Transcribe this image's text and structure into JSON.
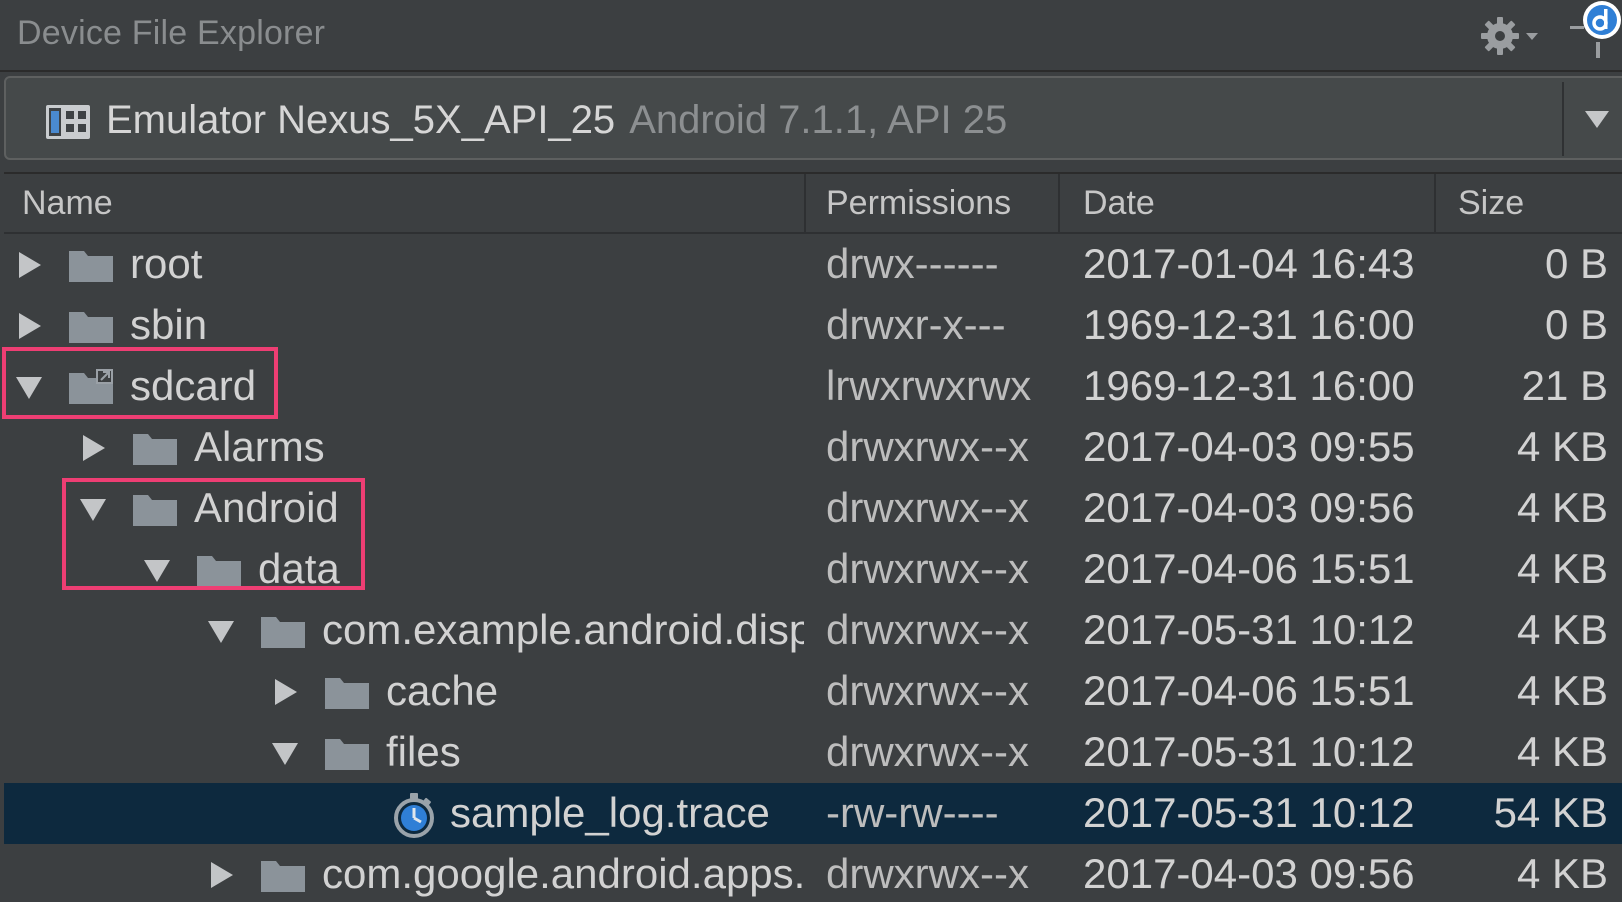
{
  "window": {
    "title": "Device File Explorer",
    "settings_icon": "gear-icon",
    "corner_icon": "d-badge-icon"
  },
  "device": {
    "name": "Emulator Nexus_5X_API_25",
    "api": "Android 7.1.1, API 25",
    "icon": "device-icon"
  },
  "columns": {
    "name": "Name",
    "permissions": "Permissions",
    "date": "Date",
    "size": "Size"
  },
  "rows": [
    {
      "name": "root",
      "permissions": "drwx------",
      "date": "2017-01-04 16:43",
      "size": "0 B",
      "depth": 0,
      "expanded": false,
      "icon": "folder-icon"
    },
    {
      "name": "sbin",
      "permissions": "drwxr-x---",
      "date": "1969-12-31 16:00",
      "size": "0 B",
      "depth": 0,
      "expanded": false,
      "icon": "folder-icon"
    },
    {
      "name": "sdcard",
      "permissions": "lrwxrwxrwx",
      "date": "1969-12-31 16:00",
      "size": "21 B",
      "depth": 0,
      "expanded": true,
      "icon": "folder-link-icon"
    },
    {
      "name": "Alarms",
      "permissions": "drwxrwx--x",
      "date": "2017-04-03 09:55",
      "size": "4 KB",
      "depth": 1,
      "expanded": false,
      "icon": "folder-icon"
    },
    {
      "name": "Android",
      "permissions": "drwxrwx--x",
      "date": "2017-04-03 09:56",
      "size": "4 KB",
      "depth": 1,
      "expanded": true,
      "icon": "folder-icon"
    },
    {
      "name": "data",
      "permissions": "drwxrwx--x",
      "date": "2017-04-06 15:51",
      "size": "4 KB",
      "depth": 2,
      "expanded": true,
      "icon": "folder-icon"
    },
    {
      "name": "com.example.android.displayingbitmaps",
      "permissions": "drwxrwx--x",
      "date": "2017-05-31 10:12",
      "size": "4 KB",
      "depth": 3,
      "expanded": true,
      "icon": "folder-icon"
    },
    {
      "name": "cache",
      "permissions": "drwxrwx--x",
      "date": "2017-04-06 15:51",
      "size": "4 KB",
      "depth": 4,
      "expanded": false,
      "icon": "folder-icon"
    },
    {
      "name": "files",
      "permissions": "drwxrwx--x",
      "date": "2017-05-31 10:12",
      "size": "4 KB",
      "depth": 4,
      "expanded": true,
      "icon": "folder-icon"
    },
    {
      "name": "sample_log.trace",
      "permissions": "-rw-rw----",
      "date": "2017-05-31 10:12",
      "size": "54 KB",
      "depth": 5,
      "expanded": null,
      "icon": "trace-file-icon",
      "selected": true
    },
    {
      "name": "com.google.android.apps.maps",
      "permissions": "drwxrwx--x",
      "date": "2017-04-03 09:56",
      "size": "4 KB",
      "depth": 3,
      "expanded": false,
      "icon": "folder-icon"
    }
  ],
  "colors": {
    "background": "#3c3f41",
    "selection": "#0d293e",
    "highlight_border": "#ee3e73",
    "folder": "#8b939a",
    "accent_blue": "#2f7fd6"
  }
}
